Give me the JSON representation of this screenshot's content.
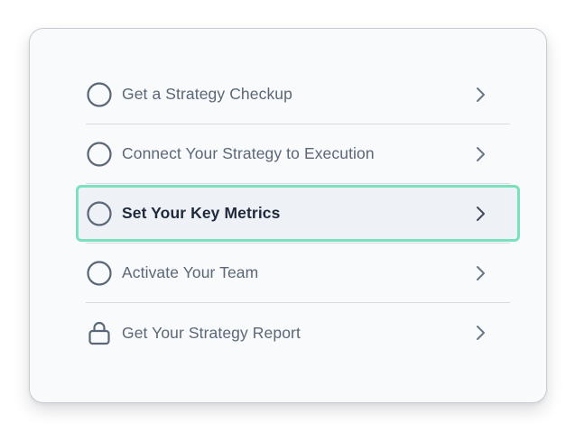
{
  "steps": [
    {
      "label": "Get a Strategy Checkup",
      "icon": "circle-icon",
      "active": false
    },
    {
      "label": "Connect Your Strategy to Execution",
      "icon": "circle-icon",
      "active": false
    },
    {
      "label": "Set Your Key Metrics",
      "icon": "circle-icon",
      "active": true
    },
    {
      "label": "Activate Your Team",
      "icon": "circle-icon",
      "active": false
    },
    {
      "label": "Get Your Strategy Report",
      "icon": "lock-icon",
      "active": false
    }
  ],
  "colors": {
    "highlight_border": "#7be0bc",
    "icon": "#5b6676",
    "text": "#5b6676",
    "active_text": "#1e293b"
  }
}
